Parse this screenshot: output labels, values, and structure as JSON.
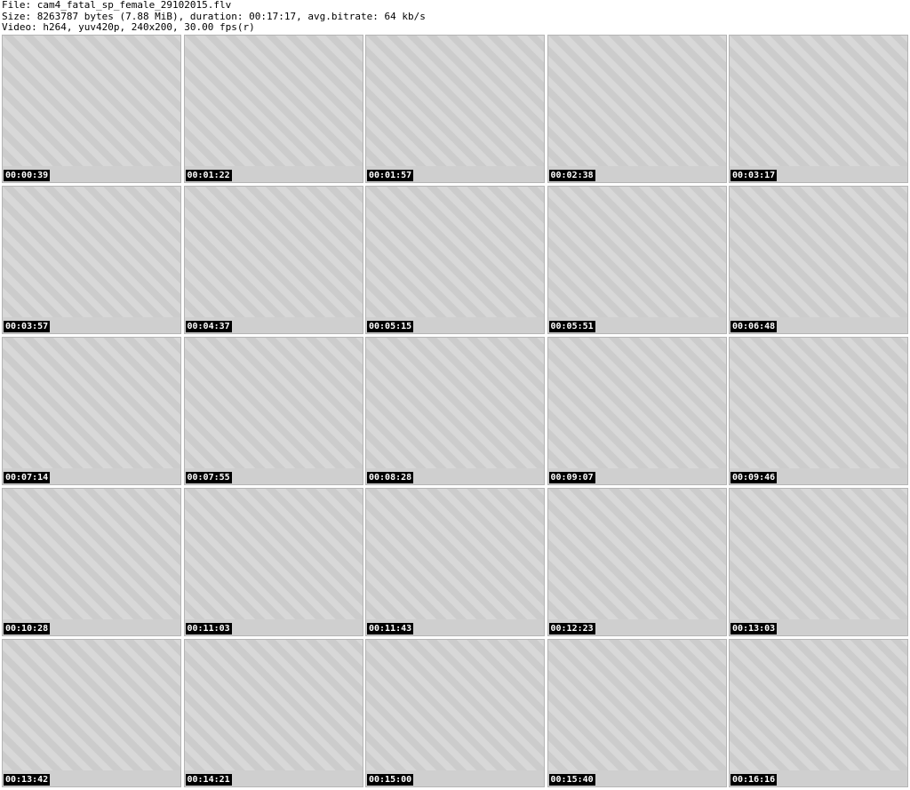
{
  "header": {
    "file_line": "File: cam4_fatal_sp_female_29102015.flv",
    "size_line": "Size: 8263787 bytes (7.88 MiB), duration: 00:17:17, avg.bitrate: 64 kb/s",
    "video_line": "Video: h264, yuv420p, 240x200, 30.00 fps(r)"
  },
  "thumbnails": [
    {
      "time": "00:00:39"
    },
    {
      "time": "00:01:22"
    },
    {
      "time": "00:01:57"
    },
    {
      "time": "00:02:38"
    },
    {
      "time": "00:03:17"
    },
    {
      "time": "00:03:57"
    },
    {
      "time": "00:04:37"
    },
    {
      "time": "00:05:15"
    },
    {
      "time": "00:05:51"
    },
    {
      "time": "00:06:48"
    },
    {
      "time": "00:07:14"
    },
    {
      "time": "00:07:55"
    },
    {
      "time": "00:08:28"
    },
    {
      "time": "00:09:07"
    },
    {
      "time": "00:09:46"
    },
    {
      "time": "00:10:28"
    },
    {
      "time": "00:11:03"
    },
    {
      "time": "00:11:43"
    },
    {
      "time": "00:12:23"
    },
    {
      "time": "00:13:03"
    },
    {
      "time": "00:13:42"
    },
    {
      "time": "00:14:21"
    },
    {
      "time": "00:15:00"
    },
    {
      "time": "00:15:40"
    },
    {
      "time": "00:16:16"
    }
  ]
}
